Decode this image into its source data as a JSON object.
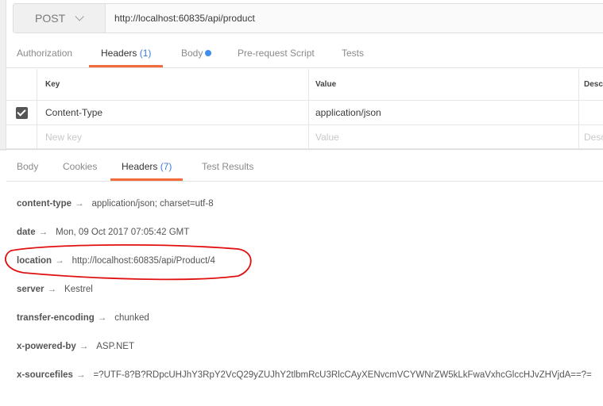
{
  "request": {
    "method": "POST",
    "url": "http://localhost:60835/api/product"
  },
  "request_tabs": {
    "authorization": "Authorization",
    "headers": "Headers",
    "headers_count": "(1)",
    "body": "Body",
    "pre_request": "Pre-request Script",
    "tests": "Tests"
  },
  "header_table": {
    "columns": {
      "key": "Key",
      "value": "Value",
      "description": "Descr"
    },
    "rows": [
      {
        "key": "Content-Type",
        "value": "application/json",
        "checked": true
      }
    ],
    "new_row": {
      "key_placeholder": "New key",
      "value_placeholder": "Value",
      "desc_placeholder": "Desc"
    }
  },
  "response_tabs": {
    "body": "Body",
    "cookies": "Cookies",
    "headers": "Headers",
    "headers_count": "(7)",
    "test_results": "Test Results"
  },
  "response_headers": [
    {
      "key": "content-type",
      "arrow": "→",
      "value": "application/json; charset=utf-8"
    },
    {
      "key": "date",
      "arrow": "→",
      "value": "Mon, 09 Oct 2017 07:05:42 GMT"
    },
    {
      "key": "location",
      "arrow": "→",
      "value": "http://localhost:60835/api/Product/4"
    },
    {
      "key": "server",
      "arrow": "→",
      "value": "Kestrel"
    },
    {
      "key": "transfer-encoding",
      "arrow": "→",
      "value": "chunked"
    },
    {
      "key": "x-powered-by",
      "arrow": "→",
      "value": "ASP.NET"
    },
    {
      "key": "x-sourcefiles",
      "arrow": "→",
      "value": "=?UTF-8?B?RDpcUHJhY3RpY2VcQ29yZUJhY2tlbmRcU3RlcCAyXENvcmVCYWNrZW5kLkFwaVxhcGlccHJvZHVjdA==?="
    }
  ],
  "colors": {
    "active_tab_underline": "#f26b3a",
    "count": "#3a7bd5",
    "dot": "#3f8fef",
    "annotation": "#e01010"
  }
}
